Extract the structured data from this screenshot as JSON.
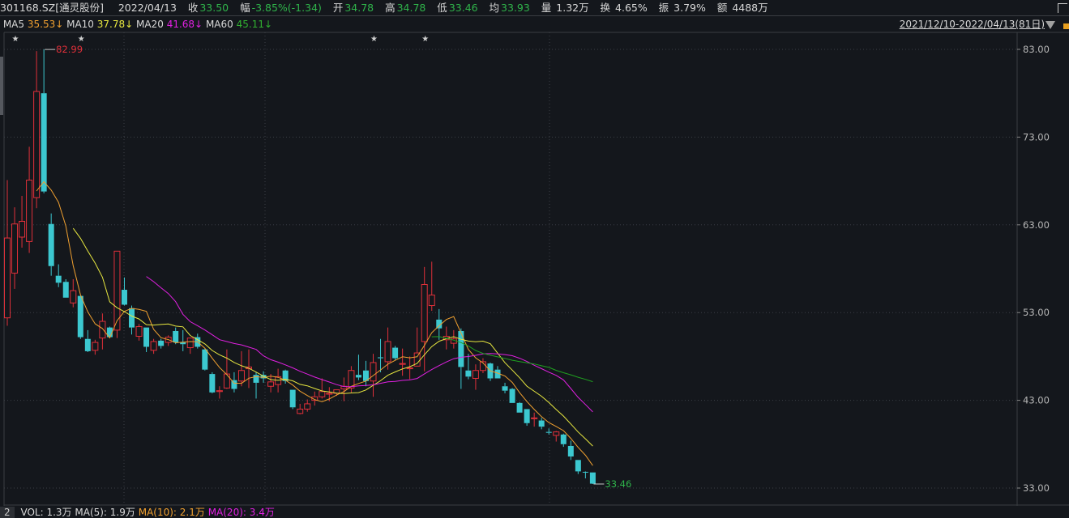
{
  "header": {
    "symbol": "301168.SZ[通灵股份]",
    "date": "2022/04/13",
    "close_label": "收",
    "close": "33.50",
    "change_label": "幅",
    "change": "-3.85%(-1.34)",
    "open_label": "开",
    "open": "34.78",
    "high_label": "高",
    "high": "34.78",
    "low_label": "低",
    "low": "33.46",
    "avg_label": "均",
    "avg": "33.93",
    "volume_label": "量",
    "volume": "1.32万",
    "turnover_label": "换",
    "turnover": "4.65%",
    "amplitude_label": "振",
    "amplitude": "3.79%",
    "amount_label": "额",
    "amount": "4488万"
  },
  "ma_legend": {
    "ma5_label": "MA5",
    "ma5": "35.53↓",
    "ma10_label": "MA10",
    "ma10": "37.78↓",
    "ma20_label": "MA20",
    "ma20": "41.68↓",
    "ma60_label": "MA60",
    "ma60": "45.11↓"
  },
  "range_selector": "2021/12/10-2022/04/13(81日)",
  "volume_panel": {
    "index": "2",
    "vol": "VOL: 1.3万",
    "ma5": "MA(5): 1.9万",
    "ma10": "MA(10): 2.1万",
    "ma20": "MA(20): 3.4万"
  },
  "chart_data": {
    "type": "candlestick",
    "ylim": [
      33,
      83
    ],
    "y_ticks": [
      "83.00",
      "73.00",
      "63.00",
      "53.00",
      "43.00",
      "33.00"
    ],
    "grid": true,
    "annotations": {
      "max": "82.99",
      "min": "33.46"
    },
    "star_marker_indices": [
      1,
      10,
      50,
      57
    ],
    "colors": {
      "up": "#e0303a",
      "down": "#3cc8d0",
      "ma5": "#f0a030",
      "ma10": "#e8e840",
      "ma20": "#e020e0",
      "ma60": "#20a020"
    },
    "ohlc": [
      [
        52.4,
        68.1,
        51.5,
        61.5
      ],
      [
        57.5,
        65.0,
        55.7,
        63.1
      ],
      [
        61.6,
        66.3,
        60.4,
        63.4
      ],
      [
        61.1,
        71.9,
        59.8,
        68.1
      ],
      [
        66.1,
        82.8,
        64.9,
        78.2
      ],
      [
        78.0,
        82.99,
        66.6,
        66.8
      ],
      [
        63.1,
        64.3,
        57.2,
        58.3
      ],
      [
        57.2,
        58.5,
        55.9,
        56.4
      ],
      [
        56.5,
        56.8,
        54.7,
        54.7
      ],
      [
        54.1,
        56.8,
        53.6,
        55.5
      ],
      [
        54.9,
        54.9,
        50.0,
        50.2
      ],
      [
        50.0,
        51.0,
        48.5,
        48.6
      ],
      [
        48.7,
        49.9,
        48.2,
        49.6
      ],
      [
        50.1,
        52.9,
        48.8,
        52.0
      ],
      [
        51.3,
        51.4,
        50.1,
        50.2
      ],
      [
        51.0,
        60.0,
        50.1,
        60.0
      ],
      [
        55.6,
        57.0,
        53.8,
        53.9
      ],
      [
        53.5,
        53.8,
        50.5,
        51.3
      ],
      [
        50.3,
        51.7,
        49.8,
        51.4
      ],
      [
        51.3,
        51.3,
        48.5,
        49.1
      ],
      [
        48.7,
        50.0,
        48.3,
        49.7
      ],
      [
        49.8,
        50.0,
        48.9,
        49.2
      ],
      [
        49.6,
        50.4,
        49.2,
        50.2
      ],
      [
        50.9,
        51.3,
        49.4,
        49.6
      ],
      [
        49.6,
        51.0,
        48.6,
        49.4
      ],
      [
        49.0,
        50.1,
        48.3,
        50.1
      ],
      [
        50.2,
        50.6,
        48.9,
        49.1
      ],
      [
        48.8,
        48.9,
        46.4,
        46.5
      ],
      [
        46.0,
        46.2,
        43.8,
        43.9
      ],
      [
        44.0,
        44.6,
        43.2,
        44.1
      ],
      [
        44.4,
        48.8,
        44.3,
        46.0
      ],
      [
        45.3,
        46.2,
        43.9,
        44.3
      ],
      [
        45.2,
        48.6,
        44.6,
        46.4
      ],
      [
        46.6,
        48.8,
        44.4,
        46.8
      ],
      [
        45.9,
        46.2,
        43.2,
        45.0
      ],
      [
        45.9,
        46.3,
        45.0,
        45.5
      ],
      [
        44.6,
        46.0,
        43.9,
        45.1
      ],
      [
        44.8,
        46.6,
        43.9,
        45.7
      ],
      [
        46.4,
        46.5,
        44.9,
        45.2
      ],
      [
        44.2,
        44.2,
        42.0,
        42.2
      ],
      [
        41.5,
        42.6,
        41.4,
        42.0
      ],
      [
        42.0,
        43.1,
        41.7,
        42.6
      ],
      [
        43.0,
        44.0,
        42.4,
        43.4
      ],
      [
        43.4,
        45.5,
        43.2,
        44.0
      ],
      [
        43.7,
        44.5,
        42.9,
        43.8
      ],
      [
        43.8,
        44.2,
        43.5,
        44.2
      ],
      [
        44.3,
        45.6,
        42.9,
        44.6
      ],
      [
        44.4,
        46.9,
        43.9,
        46.4
      ],
      [
        45.9,
        48.2,
        45.3,
        45.6
      ],
      [
        46.4,
        47.5,
        44.6,
        45.2
      ],
      [
        45.2,
        48.3,
        43.4,
        47.3
      ],
      [
        47.9,
        50.0,
        46.2,
        47.8
      ],
      [
        47.4,
        51.3,
        46.5,
        49.7
      ],
      [
        49.0,
        49.2,
        47.6,
        47.8
      ],
      [
        47.1,
        48.9,
        45.8,
        47.2
      ],
      [
        46.6,
        48.0,
        45.4,
        46.7
      ],
      [
        46.9,
        51.3,
        46.9,
        48.4
      ],
      [
        49.7,
        58.2,
        46.3,
        56.2
      ],
      [
        53.8,
        58.8,
        53.2,
        55.0
      ],
      [
        52.2,
        53.4,
        49.9,
        51.2
      ],
      [
        49.9,
        51.4,
        48.8,
        50.3
      ],
      [
        49.5,
        51.0,
        48.9,
        50.0
      ],
      [
        50.9,
        51.2,
        44.3,
        46.8
      ],
      [
        46.4,
        48.3,
        45.4,
        45.7
      ],
      [
        45.5,
        47.1,
        44.2,
        46.4
      ],
      [
        46.4,
        47.8,
        46.1,
        47.4
      ],
      [
        47.2,
        47.3,
        45.2,
        45.5
      ],
      [
        46.5,
        46.9,
        45.5,
        45.5
      ],
      [
        44.6,
        45.0,
        43.8,
        44.1
      ],
      [
        44.3,
        44.4,
        42.7,
        42.7
      ],
      [
        42.7,
        42.8,
        41.6,
        41.6
      ],
      [
        42.0,
        42.0,
        40.1,
        40.4
      ],
      [
        40.9,
        41.6,
        40.0,
        41.0
      ],
      [
        40.7,
        41.0,
        39.7,
        40.0
      ],
      [
        39.4,
        39.8,
        39.1,
        39.3
      ],
      [
        39.0,
        39.5,
        38.3,
        39.4
      ],
      [
        39.1,
        39.2,
        37.7,
        38.0
      ],
      [
        37.8,
        38.4,
        36.2,
        36.6
      ],
      [
        36.2,
        36.2,
        34.6,
        34.9
      ],
      [
        34.85,
        34.9,
        34.1,
        34.8
      ],
      [
        34.78,
        34.78,
        33.46,
        33.5
      ]
    ]
  }
}
